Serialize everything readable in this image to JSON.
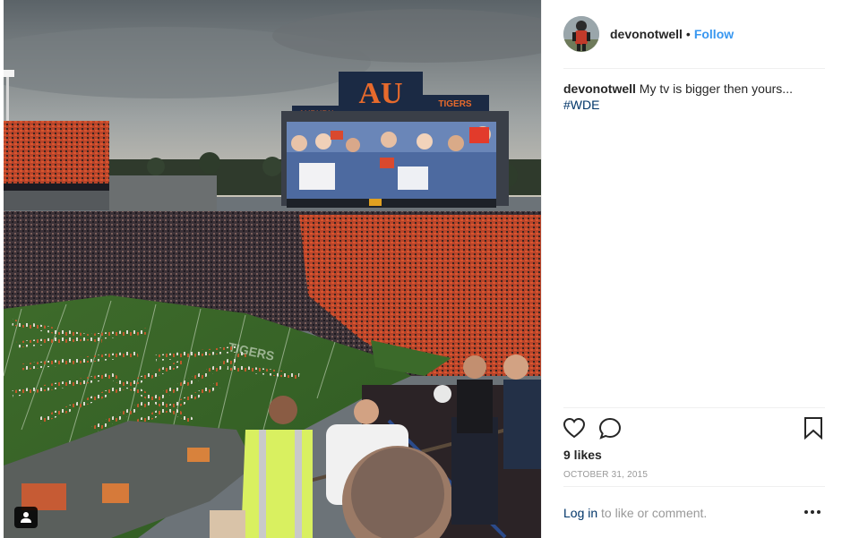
{
  "post": {
    "username": "devonotwell",
    "separator": "•",
    "follow_label": "Follow",
    "caption_user": "devonotwell",
    "caption_text": "My tv is bigger then yours...",
    "caption_hashtag": "#WDE",
    "likes_text": "9 likes",
    "date_text": "OCTOBER 31, 2015",
    "login_link": "Log in",
    "login_rest": "to like or comment."
  },
  "photo": {
    "scoreboard_left": "AUBURN",
    "scoreboard_right": "TIGERS",
    "scoreboard_logo": "AU",
    "field_text": "TIGERS"
  },
  "colors": {
    "link_blue": "#3897f0",
    "hashtag_blue": "#003569",
    "muted_gray": "#999999",
    "text_dark": "#262626"
  },
  "icons": [
    "heart-icon",
    "comment-icon",
    "bookmark-icon",
    "more-icon",
    "tag-user-icon"
  ]
}
